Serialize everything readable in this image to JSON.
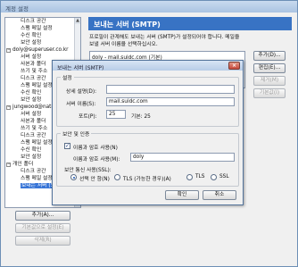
{
  "window": {
    "title": "계정 설정"
  },
  "tree": {
    "items": [
      {
        "label": "디스크 공간",
        "level": 1
      },
      {
        "label": "스팸 메일 설정",
        "level": 1
      },
      {
        "label": "수신 확인",
        "level": 1
      },
      {
        "label": "보안 설정",
        "level": 1
      },
      {
        "label": "doly@superuser.co.kr",
        "level": 0
      },
      {
        "label": "서버 설정",
        "level": 1
      },
      {
        "label": "사본과 폴더",
        "level": 1
      },
      {
        "label": "쓰기 및 주소",
        "level": 1
      },
      {
        "label": "디스크 공간",
        "level": 1
      },
      {
        "label": "스팸 메일 설정",
        "level": 1
      },
      {
        "label": "수신 확인",
        "level": 1
      },
      {
        "label": "보안 설정",
        "level": 1
      },
      {
        "label": "jungwood@nate.com",
        "level": 0
      },
      {
        "label": "서버 설정",
        "level": 1
      },
      {
        "label": "사본과 폴더",
        "level": 1
      },
      {
        "label": "쓰기 및 주소",
        "level": 1
      },
      {
        "label": "디스크 공간",
        "level": 1
      },
      {
        "label": "스팸 메일 설정",
        "level": 1
      },
      {
        "label": "수신 확인",
        "level": 1
      },
      {
        "label": "보안 설정",
        "level": 1
      },
      {
        "label": "개인 폴더",
        "level": 0
      },
      {
        "label": "디스크 공간",
        "level": 1
      },
      {
        "label": "스팸 메일 설정",
        "level": 1
      },
      {
        "label": "보내는 서버 (SMTP)",
        "level": 1,
        "selected": true
      }
    ],
    "add_button": "추가(A)...",
    "set_default_button": "기본값으로 설정(E)",
    "delete_button": "삭제(R)"
  },
  "panel": {
    "header": "보내는 서버 (SMTP)",
    "description": "프로필이 관계해도 보내는 서버 (SMTP)가 설정되어야 합니다. 메일을 보낼 서버 이름을 선택하십시오.",
    "server_item": "doly - mail.suidc.com (기본)",
    "add_button": "추가(D)...",
    "edit_button": "편집(E)...",
    "delete_button": "제거(M)",
    "default_button": "기본값(I)"
  },
  "dialog": {
    "title": "보내는 서버 (SMTP)",
    "settings_group": "설정",
    "description_label": "상세 설명(D):",
    "description_value": "",
    "server_label": "서버 이름(S):",
    "server_value": "mail.suidc.com",
    "port_label": "포트(P):",
    "port_value": "25",
    "default_port_text": "기본: 25",
    "security_group": "보안 및 인증",
    "use_auth_label": "이름과 암호 사용(N)",
    "use_auth_checked": true,
    "username_label": "이름과 암호 사용(M):",
    "username_value": "doly",
    "ssl_label": "보안 통신 사용(SSL):",
    "ssl_options": [
      "선택 안 함(N)",
      "TLS (가능한 경우)(A)",
      "TLS",
      "SSL"
    ],
    "ssl_selected": 0,
    "ok_button": "확인",
    "cancel_button": "취소"
  }
}
